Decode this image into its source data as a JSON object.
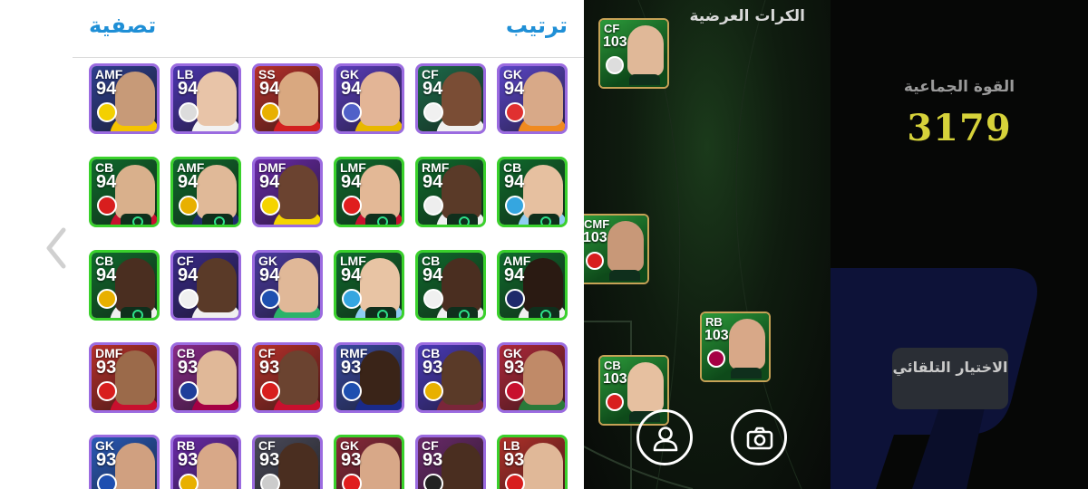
{
  "panel": {
    "filter_label": "تصفية",
    "sort_label": "ترتيب"
  },
  "players": [
    {
      "pos": "AMF",
      "ovr": "94",
      "frame": "purple",
      "bg": "#2f3f8f",
      "skin": "#c79a78",
      "kit": "#f5c400",
      "emblem": "#f3d000"
    },
    {
      "pos": "LB",
      "ovr": "94",
      "frame": "purple",
      "bg": "#4c35b0",
      "skin": "#e8c4a8",
      "kit": "#f2f2f2",
      "emblem": "#dcdcdc"
    },
    {
      "pos": "SS",
      "ovr": "94",
      "frame": "purple",
      "bg": "#b8302a",
      "skin": "#d9a880",
      "kit": "#d22020",
      "emblem": "#e8b000"
    },
    {
      "pos": "GK",
      "ovr": "94",
      "frame": "purple",
      "bg": "#5a3dbb",
      "skin": "#e3b596",
      "kit": "#e8b800",
      "emblem": "#5060c8"
    },
    {
      "pos": "CF",
      "ovr": "94",
      "frame": "purple",
      "bg": "#1d6b4a",
      "skin": "#7a4d35",
      "kit": "#f0f0f0",
      "emblem": "#f0f0f0"
    },
    {
      "pos": "GK",
      "ovr": "94",
      "frame": "purple",
      "bg": "#5b45c8",
      "skin": "#d8a988",
      "kit": "#f08a20",
      "emblem": "#e03030"
    },
    {
      "pos": "CB",
      "ovr": "94",
      "frame": "green",
      "bg": "#0f6b2c",
      "skin": "#d9b08c",
      "kit": "#c8102e",
      "emblem": "#d81e1e"
    },
    {
      "pos": "AMF",
      "ovr": "94",
      "frame": "green",
      "bg": "#0f6b2c",
      "skin": "#e0b998",
      "kit": "#1e2a6b",
      "emblem": "#e8b000"
    },
    {
      "pos": "DMF",
      "ovr": "94",
      "frame": "purple",
      "bg": "#6a2aa8",
      "skin": "#6b4330",
      "kit": "#f5d400",
      "emblem": "#f5d400"
    },
    {
      "pos": "LMF",
      "ovr": "94",
      "frame": "green",
      "bg": "#0f6b2c",
      "skin": "#e3b896",
      "kit": "#c8102e",
      "emblem": "#e01e1e"
    },
    {
      "pos": "RMF",
      "ovr": "94",
      "frame": "green",
      "bg": "#0f6b2c",
      "skin": "#5a3a28",
      "kit": "#f0f0f0",
      "emblem": "#eeeeee"
    },
    {
      "pos": "CB",
      "ovr": "94",
      "frame": "green",
      "bg": "#0f6b2c",
      "skin": "#e6c0a0",
      "kit": "#8ecdf2",
      "emblem": "#35a6e0"
    },
    {
      "pos": "CB",
      "ovr": "94",
      "frame": "green",
      "bg": "#0f6b2c",
      "skin": "#4a2e20",
      "kit": "#f0f0f0",
      "emblem": "#e8b000"
    },
    {
      "pos": "CF",
      "ovr": "94",
      "frame": "purple",
      "bg": "#3a2a8a",
      "skin": "#5a3a28",
      "kit": "#f0f0f0",
      "emblem": "#f0f0f0"
    },
    {
      "pos": "GK",
      "ovr": "94",
      "frame": "purple",
      "bg": "#4a3aa0",
      "skin": "#e0b898",
      "kit": "#2ab36a",
      "emblem": "#1e4fb0"
    },
    {
      "pos": "LMF",
      "ovr": "94",
      "frame": "green",
      "bg": "#0f6b2c",
      "skin": "#e8c4a4",
      "kit": "#8ecdf2",
      "emblem": "#35a6e0"
    },
    {
      "pos": "CB",
      "ovr": "94",
      "frame": "green",
      "bg": "#0f6b2c",
      "skin": "#4a2e20",
      "kit": "#f0f0f0",
      "emblem": "#f0f0f0"
    },
    {
      "pos": "AMF",
      "ovr": "94",
      "frame": "green",
      "bg": "#0f6b2c",
      "skin": "#2a1a12",
      "kit": "#f0f0f0",
      "emblem": "#1e2a6b"
    },
    {
      "pos": "DMF",
      "ovr": "93",
      "frame": "purple",
      "bg": "#b8302a",
      "skin": "#9b6a4a",
      "kit": "#c8102e",
      "emblem": "#d81e1e"
    },
    {
      "pos": "CB",
      "ovr": "93",
      "frame": "purple",
      "bg": "#8a2a8a",
      "skin": "#e0b898",
      "kit": "#a50044",
      "emblem": "#1e3e9a"
    },
    {
      "pos": "CF",
      "ovr": "93",
      "frame": "purple",
      "bg": "#b8302a",
      "skin": "#6b4330",
      "kit": "#c8102e",
      "emblem": "#d81e1e"
    },
    {
      "pos": "RMF",
      "ovr": "93",
      "frame": "purple",
      "bg": "#3a4aa0",
      "skin": "#3a2418",
      "kit": "#1a2a8a",
      "emblem": "#1e4fb0"
    },
    {
      "pos": "CB",
      "ovr": "93",
      "frame": "purple",
      "bg": "#4a3ab8",
      "skin": "#5a3a28",
      "kit": "#7a263a",
      "emblem": "#e8b000"
    },
    {
      "pos": "GK",
      "ovr": "93",
      "frame": "purple",
      "bg": "#b0283a",
      "skin": "#c08a68",
      "kit": "#2a7a3a",
      "emblem": "#c8102e"
    },
    {
      "pos": "GK",
      "ovr": "93",
      "frame": "purple",
      "bg": "#2a5ab8",
      "skin": "#d0a080",
      "kit": "#3a3a3a",
      "emblem": "#1e4fb0"
    },
    {
      "pos": "RB",
      "ovr": "93",
      "frame": "purple",
      "bg": "#6a2aa8",
      "skin": "#d8a888",
      "kit": "#d42e6a",
      "emblem": "#e8b000"
    },
    {
      "pos": "CF",
      "ovr": "93",
      "frame": "purple",
      "bg": "#4a4a5a",
      "skin": "#4a2e20",
      "kit": "#8ecdf2",
      "emblem": "#cccccc"
    },
    {
      "pos": "GK",
      "ovr": "93",
      "frame": "green",
      "bg": "#8a2a3a",
      "skin": "#d8a888",
      "kit": "#d81e1e",
      "emblem": "#e01e1e"
    },
    {
      "pos": "CF",
      "ovr": "93",
      "frame": "purple",
      "bg": "#6a2a6a",
      "skin": "#4a2e20",
      "kit": "#f0f0f0",
      "emblem": "#222222"
    },
    {
      "pos": "LB",
      "ovr": "93",
      "frame": "green",
      "bg": "#b0302a",
      "skin": "#e0b898",
      "kit": "#d81e1e",
      "emblem": "#d81e1e"
    }
  ],
  "field": {
    "title": "الكرات العرضية",
    "cards": [
      {
        "pos": "CF",
        "ovr": "103",
        "skin": "#e0b898",
        "emblem": "#dddddd"
      },
      {
        "pos": "CMF",
        "ovr": "103",
        "skin": "#c89878",
        "emblem": "#d81e1e"
      },
      {
        "pos": "RB",
        "ovr": "103",
        "skin": "#d8a888",
        "emblem": "#a50044"
      },
      {
        "pos": "CB",
        "ovr": "103",
        "skin": "#e6c0a0",
        "emblem": "#d81e1e"
      }
    ]
  },
  "team": {
    "strength_label": "القوة الجماعية",
    "strength_value": "3179",
    "auto_select_label": "الاختيار التلقائي"
  },
  "colors": {
    "accent": "#1f8fd6",
    "frame_green": "#3ad12c",
    "frame_purple": "#9b6be0",
    "strength": "#d6d23a"
  },
  "icons": [
    "chevron-left-icon",
    "profile-icon",
    "camera-icon"
  ]
}
